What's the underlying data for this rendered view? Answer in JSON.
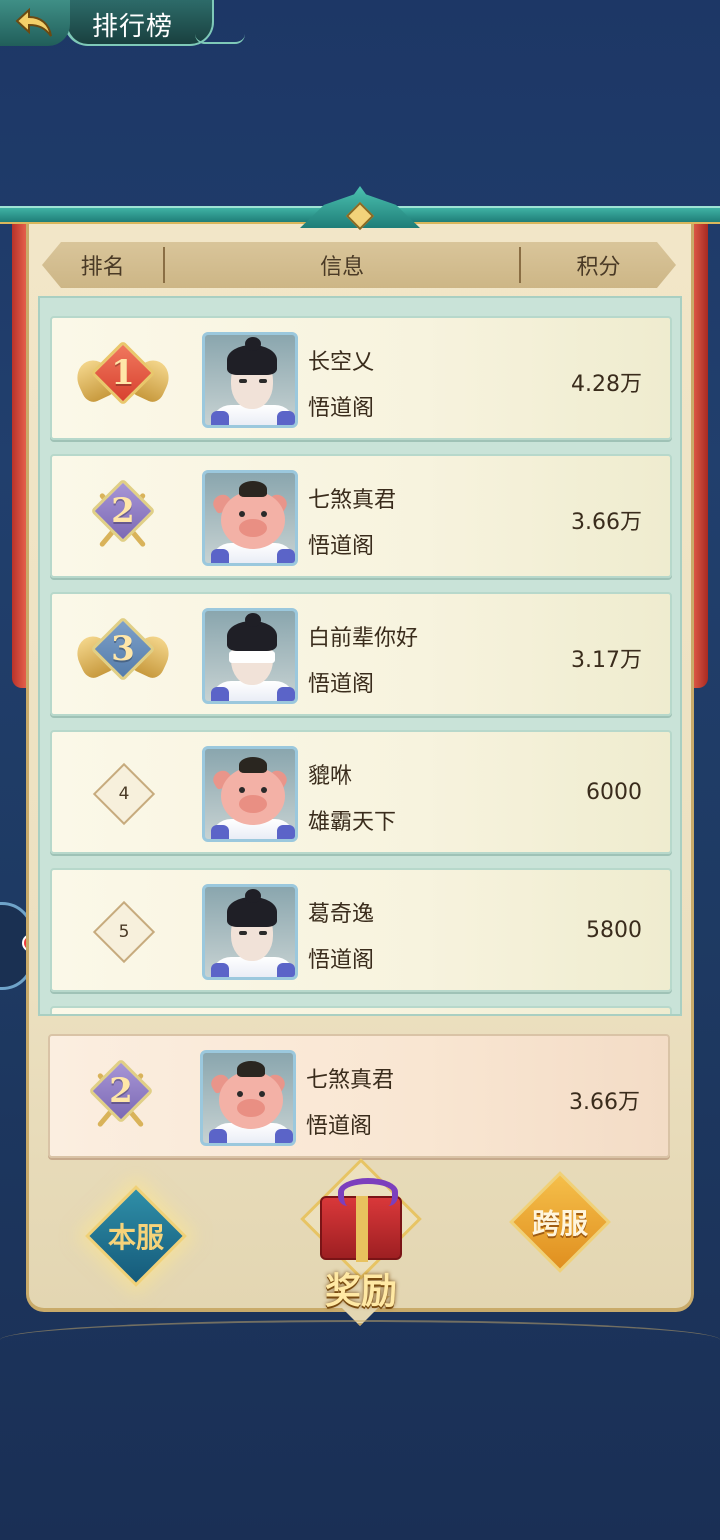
{
  "header": {
    "title": "排行榜"
  },
  "table": {
    "col_rank": "排名",
    "col_info": "信息",
    "col_score": "积分"
  },
  "rows": [
    {
      "rank": "1",
      "name": "长空乂",
      "guild": "悟道阁",
      "score": "4.28万",
      "avatar": "scholar-avatar"
    },
    {
      "rank": "2",
      "name": "七煞真君",
      "guild": "悟道阁",
      "score": "3.66万",
      "avatar": "pig-avatar"
    },
    {
      "rank": "3",
      "name": "白前辈你好",
      "guild": "悟道阁",
      "score": "3.17万",
      "avatar": "blindfold-avatar"
    },
    {
      "rank": "4",
      "name": "貔咻",
      "guild": "雄霸天下",
      "score": "6000",
      "avatar": "pig-avatar"
    },
    {
      "rank": "5",
      "name": "葛奇逸",
      "guild": "悟道阁",
      "score": "5800",
      "avatar": "elder-avatar"
    }
  ],
  "my_row": {
    "rank": "2",
    "name": "七煞真君",
    "guild": "悟道阁",
    "score": "3.66万",
    "avatar": "pig-avatar"
  },
  "tabs": {
    "local": "本服",
    "cross": "跨服",
    "reward": "奖励"
  },
  "colors": {
    "panel": "#f2e6c8",
    "accent_teal": "#1f7e78",
    "curtain_red": "#d8412f",
    "background": "#1d3766"
  }
}
